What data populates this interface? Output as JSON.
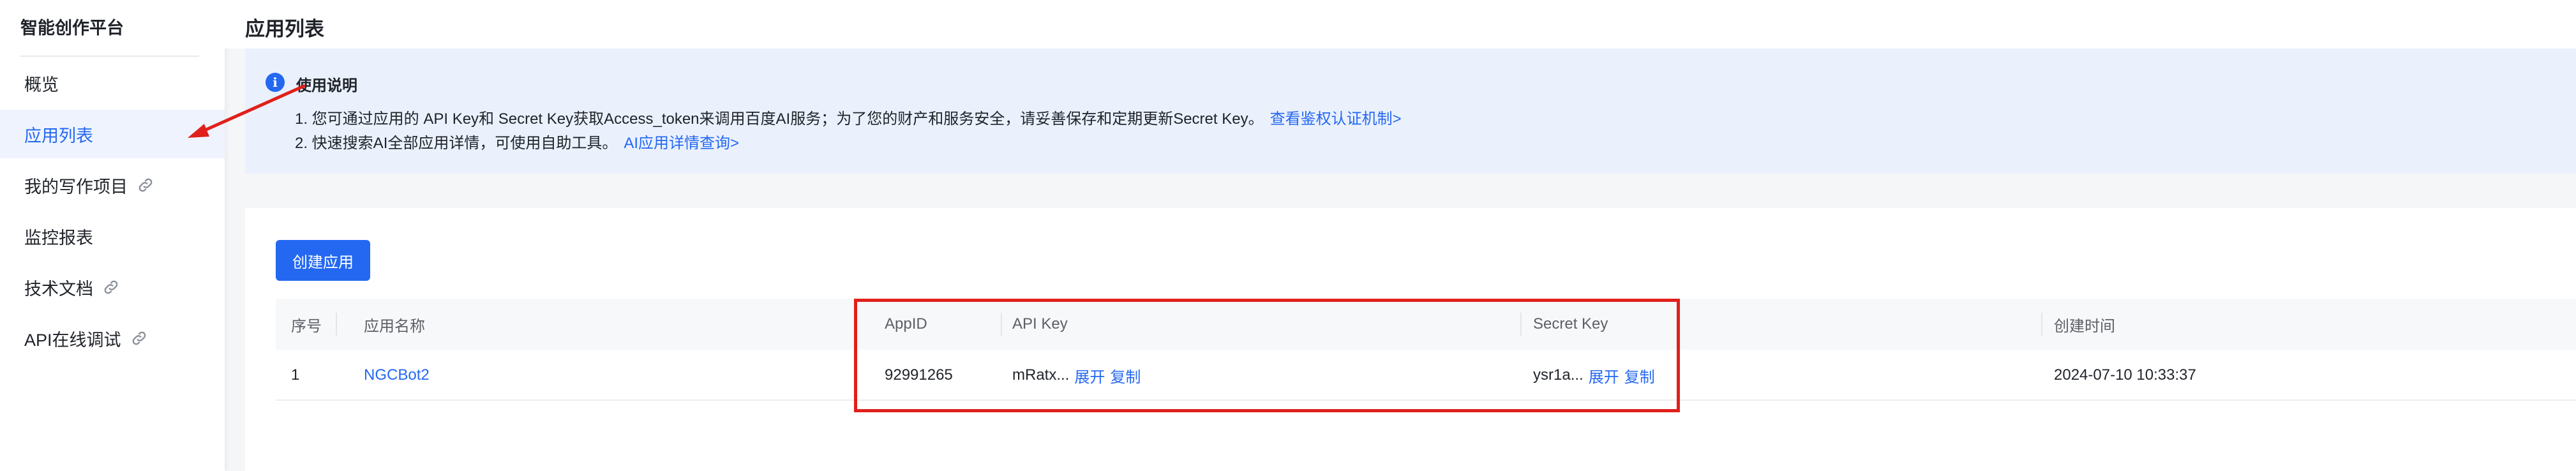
{
  "sidebar": {
    "title": "智能创作平台",
    "items": [
      {
        "label": "概览"
      },
      {
        "label": "应用列表"
      },
      {
        "label": "我的写作项目"
      },
      {
        "label": "监控报表"
      },
      {
        "label": "技术文档"
      },
      {
        "label": "API在线调试"
      }
    ]
  },
  "page": {
    "title": "应用列表"
  },
  "notice": {
    "icon": "info-icon",
    "icon_glyph": "i",
    "title": "使用说明",
    "line1": "1. 您可通过应用的 API Key和 Secret Key获取Access_token来调用百度AI服务；为了您的财产和服务安全，请妥善保存和定期更新Secret Key。",
    "line1_link": "查看鉴权认证机制>",
    "line2": "2. 快速搜索AI全部应用详情，可使用自助工具。",
    "line2_link": "AI应用详情查询>"
  },
  "toolbar": {
    "create_label": "创建应用"
  },
  "table": {
    "headers": {
      "index": "序号",
      "name": "应用名称",
      "appid": "AppID",
      "apikey": "API Key",
      "secretkey": "Secret Key",
      "created": "创建时间"
    },
    "rows": [
      {
        "index": "1",
        "name": "NGCBot2",
        "appid": "92991265",
        "apikey": "mRatx...",
        "secretkey": "ysr1a...",
        "expand": "展开",
        "copy": "复制",
        "created": "2024-07-10 10:33:37"
      }
    ]
  },
  "colors": {
    "accent": "#2468f2",
    "highlight": "#e0201b",
    "notice_bg": "#eaf1fd"
  }
}
